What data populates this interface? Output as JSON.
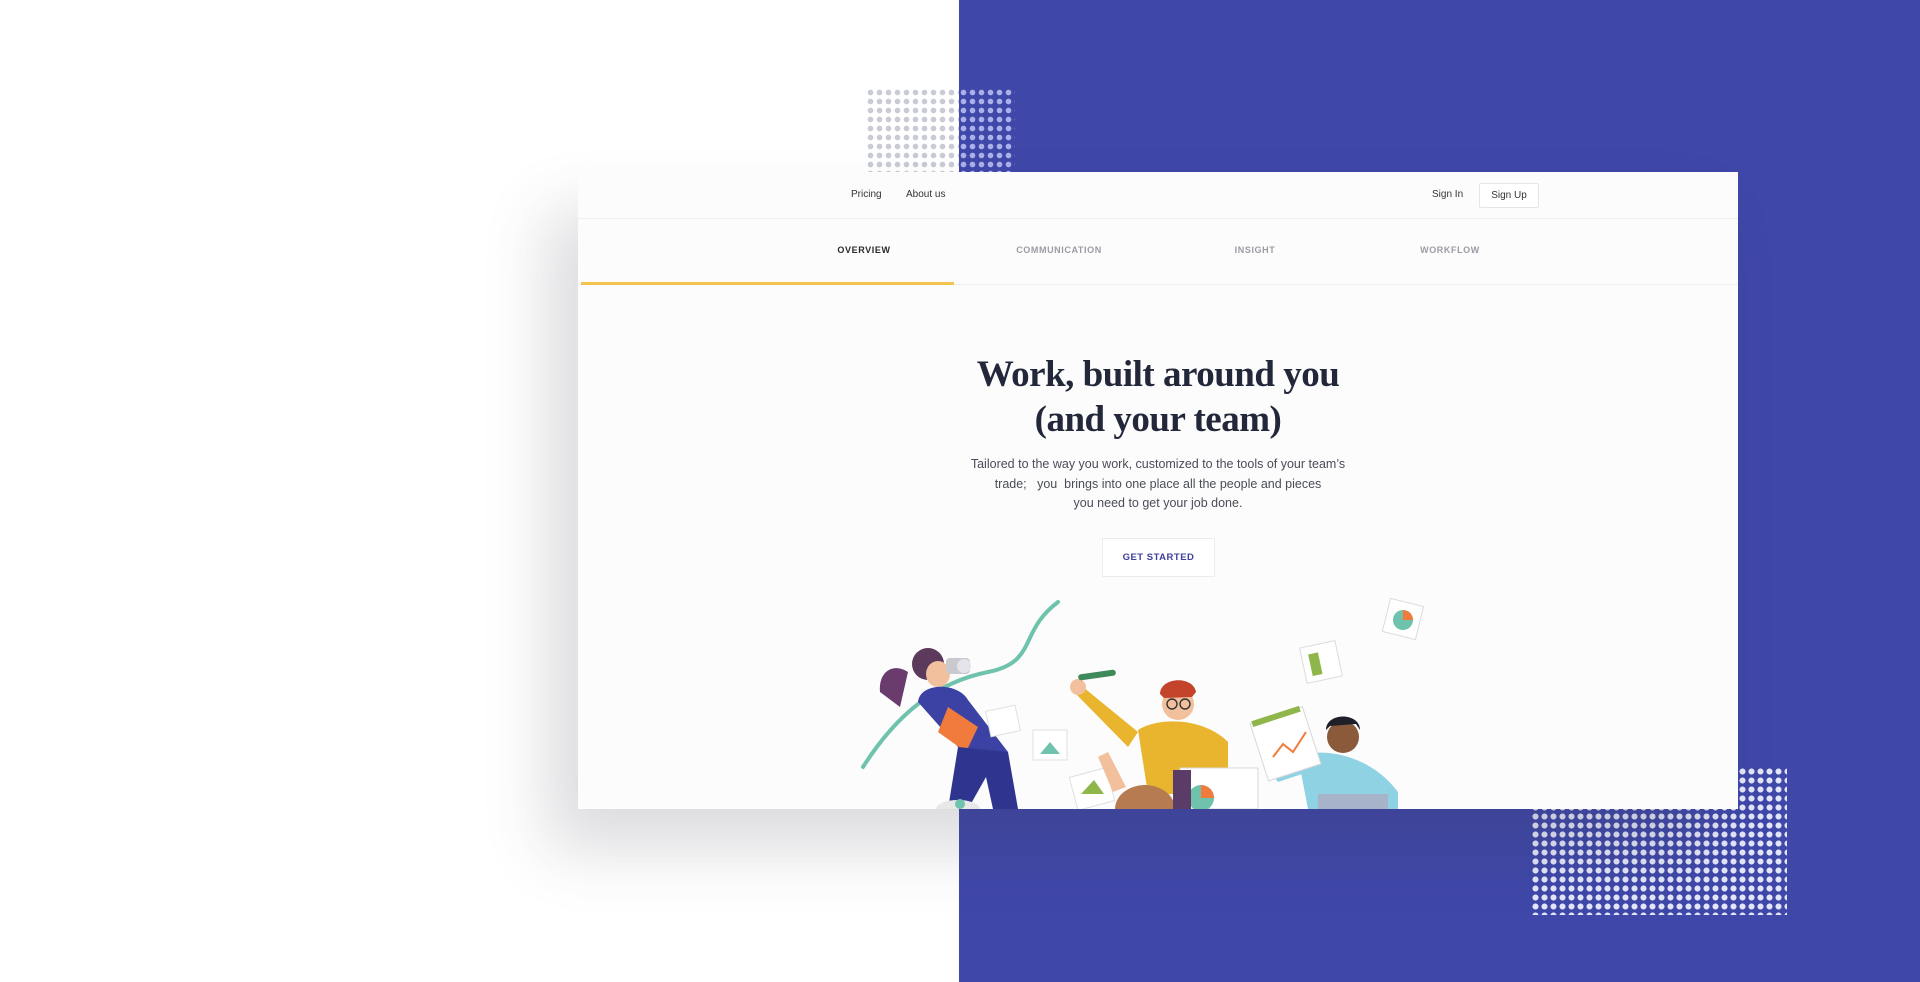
{
  "nav": {
    "pricing": "Pricing",
    "about": "About us",
    "signin": "Sign In",
    "signup": "Sign Up"
  },
  "tabs": [
    {
      "label": "OVERVIEW",
      "active": true
    },
    {
      "label": "COMMUNICATION",
      "active": false
    },
    {
      "label": "INSIGHT",
      "active": false
    },
    {
      "label": "WORKFLOW",
      "active": false
    }
  ],
  "hero": {
    "title_line1": "Work, built around you",
    "title_line2": "(and your team)",
    "subtitle_line1": "Tailored to the way you work, customized to the tools of your team’s",
    "subtitle_line2": "trade;   you  brings into one place all the people and pieces",
    "subtitle_line3": "you need to get your job done.",
    "cta": "GET STARTED"
  },
  "colors": {
    "brand_blue": "#3f47a8",
    "accent_yellow": "#f3c44d",
    "headline": "#22273a",
    "cta_text": "#3d3f9e"
  },
  "illustration": {
    "icon": "team-collaboration-illustration"
  }
}
